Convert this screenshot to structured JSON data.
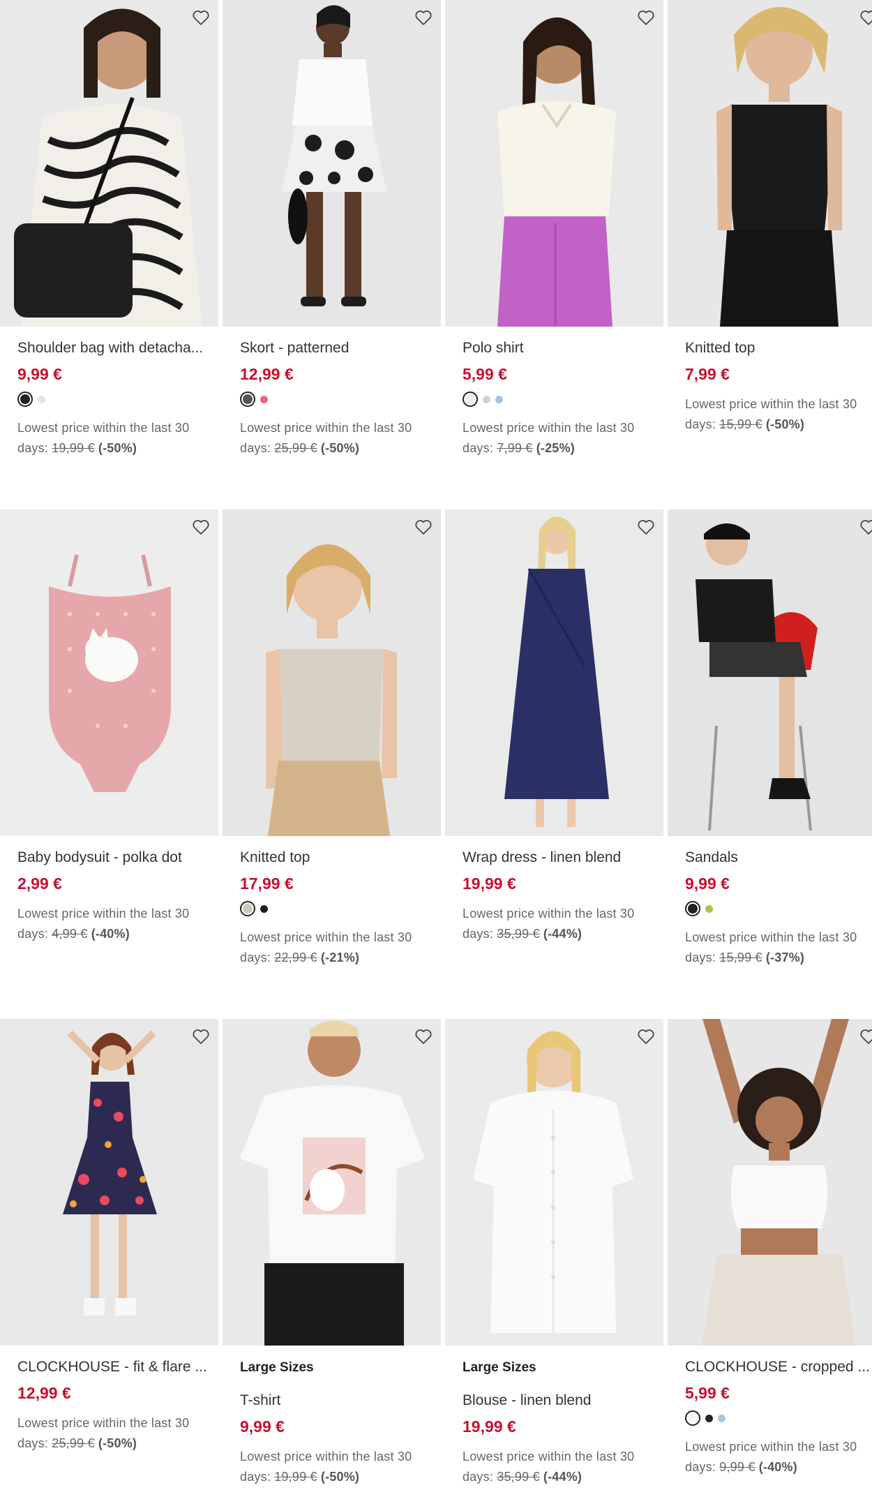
{
  "products": [
    {
      "title": "Shoulder bag with detacha...",
      "price": "9,99 €",
      "swatches": [
        "#222222",
        "#e8e4da"
      ],
      "lowest_label": "Lowest price within the last 30",
      "days_label": "days:",
      "old_price": "19,99 €",
      "discount": "(-50%)"
    },
    {
      "title": "Skort - patterned",
      "price": "12,99 €",
      "swatches": [
        "#555555",
        "#e36a7a"
      ],
      "lowest_label": "Lowest price within the last 30",
      "days_label": "days:",
      "old_price": "25,99 €",
      "discount": "(-50%)"
    },
    {
      "title": "Polo shirt",
      "price": "5,99 €",
      "swatches": [
        "#f4f1e8",
        "#c9d3dc",
        "#a9c4da"
      ],
      "lowest_label": "Lowest price within the last 30",
      "days_label": "days:",
      "old_price": "7,99 €",
      "discount": "(-25%)"
    },
    {
      "title": "Knitted top",
      "price": "7,99 €",
      "swatches": [],
      "lowest_label": "Lowest price within the last 30",
      "days_label": "days:",
      "old_price": "15,99 €",
      "discount": "(-50%)"
    },
    {
      "title": "Baby bodysuit - polka dot",
      "price": "2,99 €",
      "swatches": [],
      "lowest_label": "Lowest price within the last 30",
      "days_label": "days:",
      "old_price": "4,99 €",
      "discount": "(-40%)"
    },
    {
      "title": "Knitted top",
      "price": "17,99 €",
      "swatches": [
        "#cfc6bb",
        "#222222"
      ],
      "lowest_label": "Lowest price within the last 30",
      "days_label": "days:",
      "old_price": "22,99 €",
      "discount": "(-21%)"
    },
    {
      "title": "Wrap dress - linen blend",
      "price": "19,99 €",
      "swatches": [],
      "lowest_label": "Lowest price within the last 30",
      "days_label": "days:",
      "old_price": "35,99 €",
      "discount": "(-44%)"
    },
    {
      "title": "Sandals",
      "price": "9,99 €",
      "swatches": [
        "#222222",
        "#a8c64a"
      ],
      "lowest_label": "Lowest price within the last 30",
      "days_label": "days:",
      "old_price": "15,99 €",
      "discount": "(-37%)"
    },
    {
      "title": "CLOCKHOUSE - fit & flare ...",
      "price": "12,99 €",
      "swatches": [],
      "lowest_label": "Lowest price within the last 30",
      "days_label": "days:",
      "old_price": "25,99 €",
      "discount": "(-50%)"
    },
    {
      "badge": "Large Sizes",
      "title": "T-shirt",
      "price": "9,99 €",
      "swatches": [],
      "lowest_label": "Lowest price within the last 30",
      "days_label": "days:",
      "old_price": "19,99 €",
      "discount": "(-50%)"
    },
    {
      "badge": "Large Sizes",
      "title": "Blouse - linen blend",
      "price": "19,99 €",
      "swatches": [],
      "lowest_label": "Lowest price within the last 30",
      "days_label": "days:",
      "old_price": "35,99 €",
      "discount": "(-44%)"
    },
    {
      "title": "CLOCKHOUSE - cropped ...",
      "price": "5,99 €",
      "swatches": [
        "#f4f4f4",
        "#222222",
        "#a9c4e4"
      ],
      "lowest_label": "Lowest price within the last 30",
      "days_label": "days:",
      "old_price": "9,99 €",
      "discount": "(-40%)"
    }
  ],
  "icons": {
    "wishlist": "heart-outline-icon"
  },
  "colors": {
    "price": "#c8102e",
    "text": "#333333"
  }
}
